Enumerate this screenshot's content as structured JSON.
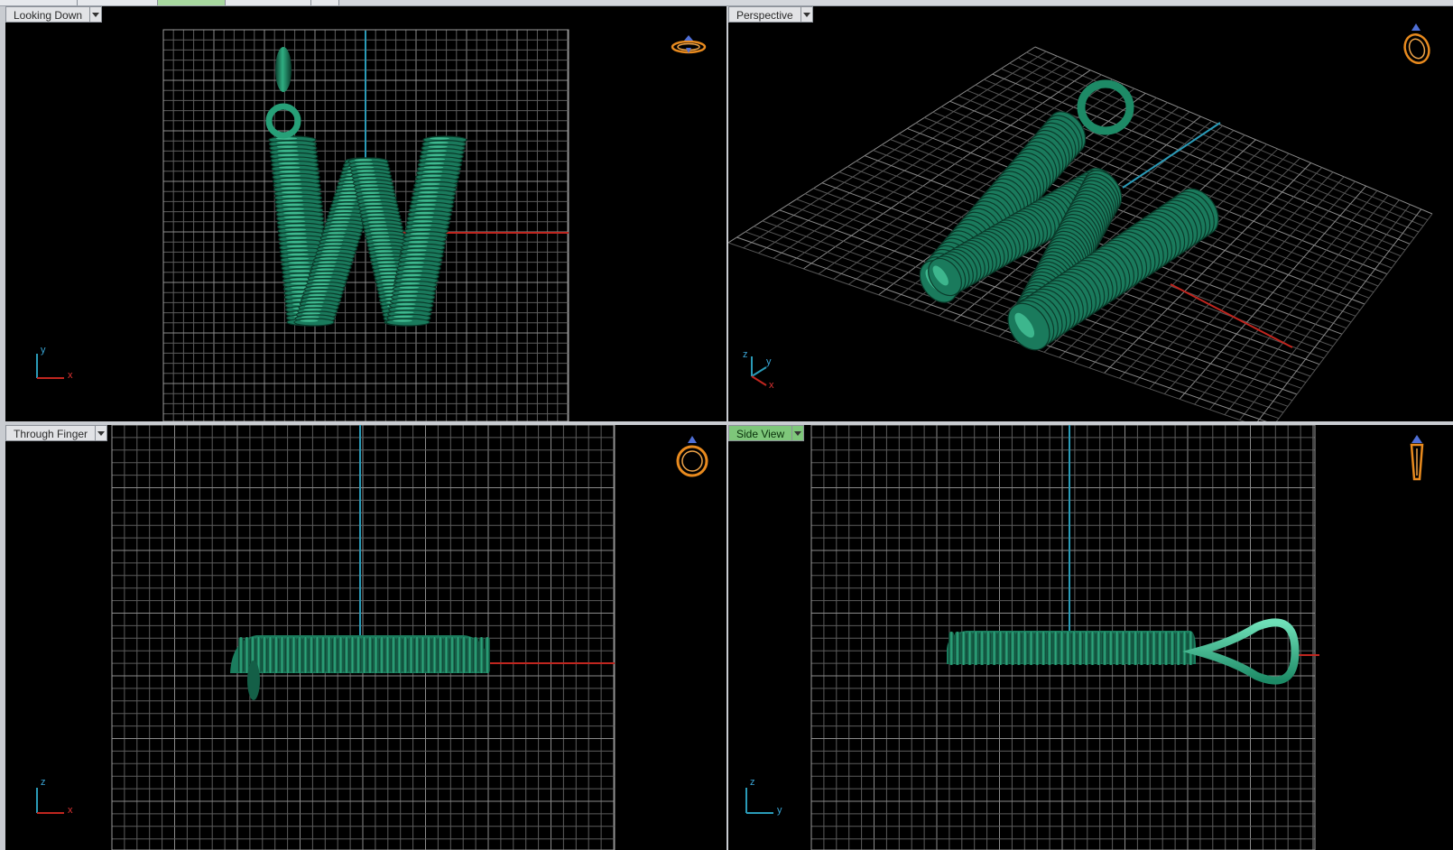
{
  "viewports": {
    "top": {
      "label": "Looking Down",
      "axis1": "y",
      "axis2": "x"
    },
    "perspective": {
      "label": "Perspective",
      "axis1": "z",
      "axis2": "y",
      "axis3": "x"
    },
    "front": {
      "label": "Through Finger",
      "axis1": "z",
      "axis2": "x"
    },
    "side": {
      "label": "Side View",
      "axis1": "z",
      "axis2": "y"
    }
  },
  "active_viewport": "Side View",
  "icons": {
    "top": "ring-top-view-icon",
    "perspective": "ring-perspective-icon",
    "front": "ring-front-view-icon",
    "side": "ring-side-view-icon"
  },
  "colors": {
    "background": "#000000",
    "grid": "#5c5c5c",
    "grid_border": "#9a9a9a",
    "axis_x": "#c0261f",
    "axis_y": "#2a9bb8",
    "model": "#1a7a5c",
    "model_highlight": "#3fbf92",
    "active_label": "#7ec77a",
    "nav_icon": "#e88a1e"
  }
}
